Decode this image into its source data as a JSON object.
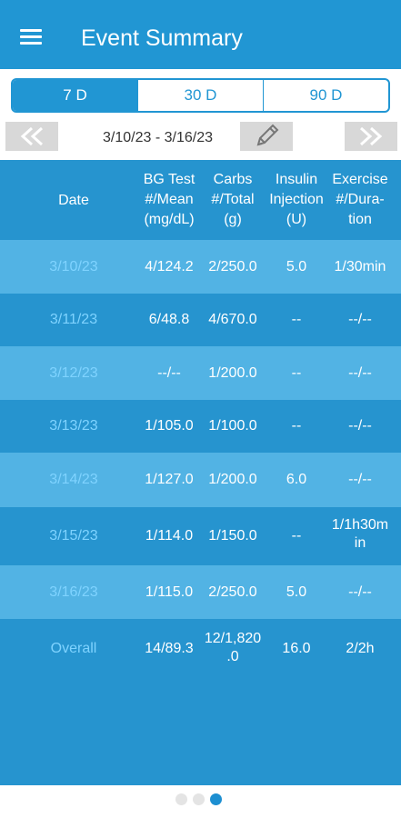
{
  "appbar": {
    "title": "Event Summary",
    "menu_icon": "hamburger-menu-icon"
  },
  "tabs": [
    {
      "label": "7 D",
      "active": true
    },
    {
      "label": "30 D",
      "active": false
    },
    {
      "label": "90 D",
      "active": false
    }
  ],
  "navigation": {
    "date_range": "3/10/23 - 3/16/23",
    "prev_icon": "double-chevron-left-icon",
    "next_icon": "double-chevron-right-icon",
    "edit_icon": "pencil-icon"
  },
  "table": {
    "headers": {
      "date": "Date",
      "bg": [
        "BG Test",
        "#/Mean",
        "(mg/dL)"
      ],
      "carbs": [
        "Carbs",
        "#/Total",
        "(g)"
      ],
      "insulin": [
        "Insulin",
        "Injection",
        "(U)"
      ],
      "exercise": [
        "Exercise",
        "#/Dura-",
        "tion"
      ]
    },
    "rows": [
      {
        "date": "3/10/23",
        "bg": "4/124.2",
        "carbs": "2/250.0",
        "insulin": "5.0",
        "exercise": "1/30min"
      },
      {
        "date": "3/11/23",
        "bg": "6/48.8",
        "carbs": "4/670.0",
        "insulin": "--",
        "exercise": "--/--"
      },
      {
        "date": "3/12/23",
        "bg": "--/--",
        "carbs": "1/200.0",
        "insulin": "--",
        "exercise": "--/--"
      },
      {
        "date": "3/13/23",
        "bg": "1/105.0",
        "carbs": "1/100.0",
        "insulin": "--",
        "exercise": "--/--"
      },
      {
        "date": "3/14/23",
        "bg": "1/127.0",
        "carbs": "1/200.0",
        "insulin": "6.0",
        "exercise": "--/--"
      },
      {
        "date": "3/15/23",
        "bg": "1/114.0",
        "carbs": "1/150.0",
        "insulin": "--",
        "exercise": [
          "1/1h30m",
          "in"
        ]
      },
      {
        "date": "3/16/23",
        "bg": "1/115.0",
        "carbs": "2/250.0",
        "insulin": "5.0",
        "exercise": "--/--"
      }
    ],
    "overall": {
      "date": "Overall",
      "bg": "14/89.3",
      "carbs": [
        "12/1,820",
        ".0"
      ],
      "insulin": "16.0",
      "exercise": "2/2h"
    }
  },
  "pager": {
    "count": 3,
    "active_index": 2
  }
}
